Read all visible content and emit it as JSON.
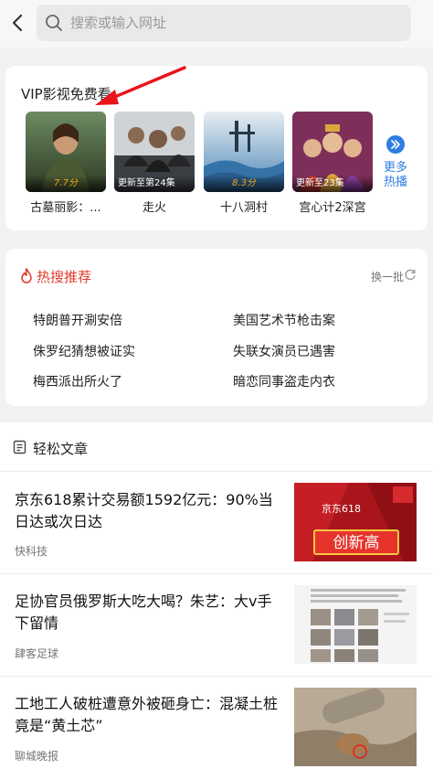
{
  "search": {
    "placeholder": "搜索或输入网址"
  },
  "vip": {
    "title": "VIP影视免费看",
    "movies": [
      {
        "title": "古墓丽影：...",
        "badge": "7.7分"
      },
      {
        "title": "走火",
        "badge": "更新至第24集"
      },
      {
        "title": "十八洞村",
        "badge": "8.3分"
      },
      {
        "title": "宫心计2深宫",
        "badge": "更新至23集"
      }
    ],
    "more_line1": "更多",
    "more_line2": "热播"
  },
  "hot": {
    "title": "热搜推荐",
    "refresh_label": "换一批",
    "items": [
      "特朗普开涮安倍",
      "美国艺术节枪击案",
      "侏罗纪猜想被证实",
      "失联女演员已遇害",
      "梅西派出所火了",
      "暗恋同事盗走内衣"
    ]
  },
  "articles": {
    "heading": "轻松文章",
    "items": [
      {
        "title": "京东618累计交易额1592亿元：90%当日达或次日达",
        "source": "快科技",
        "thumb_text": "创新高",
        "thumb_small": "京东618"
      },
      {
        "title": "足协官员俄罗斯大吃大喝？朱艺：大v手下留情",
        "source": "肆客足球"
      },
      {
        "title": "工地工人破桩遭意外被砸身亡：混凝土桩竟是“黄土芯”",
        "source": "聊城晚报"
      }
    ]
  },
  "colors": {
    "accent_blue": "#2f7de1",
    "hot_red": "#e0392b",
    "annotation_red": "#e8141c"
  }
}
